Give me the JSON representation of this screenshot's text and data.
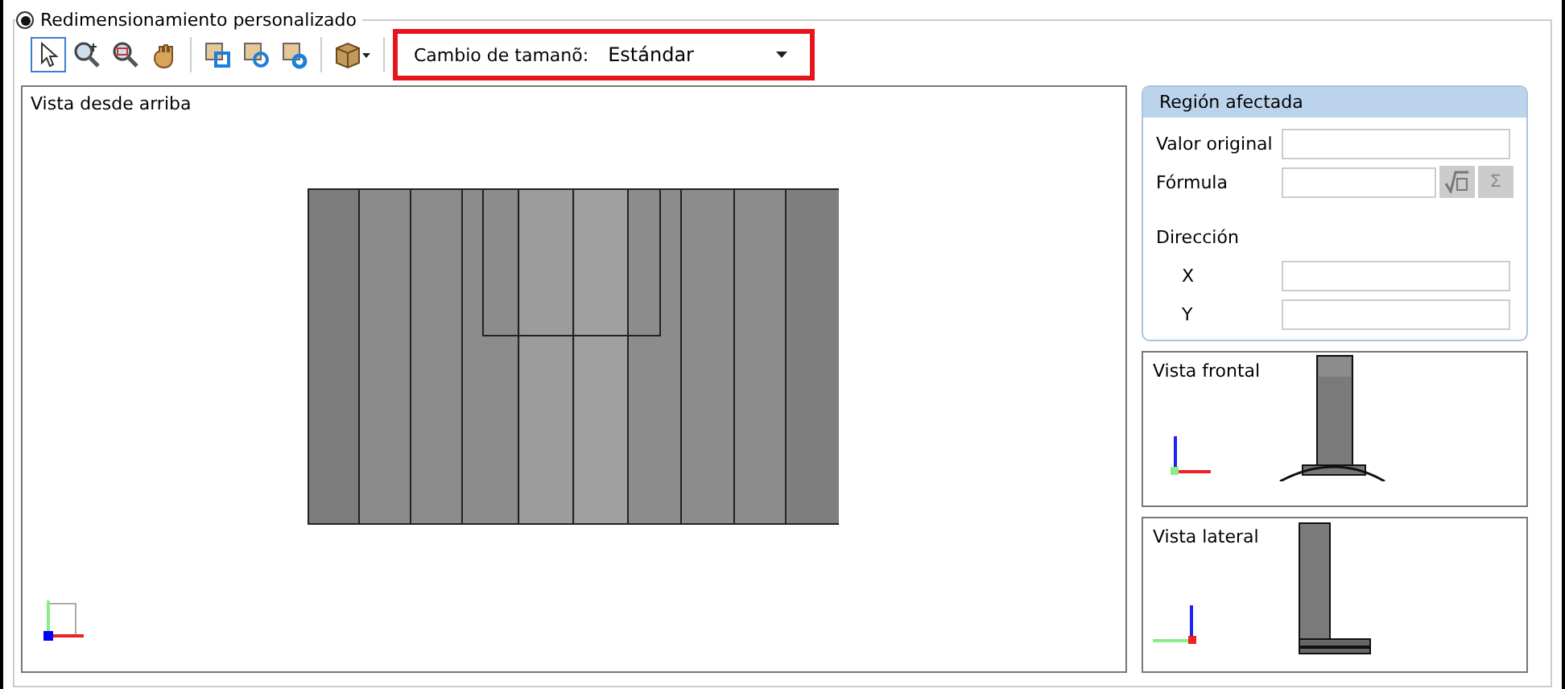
{
  "mode_radio": {
    "label": "Redimensionamiento personalizado",
    "selected": true
  },
  "toolbar": {
    "tools": [
      {
        "kind": "pointer",
        "selected": true
      },
      {
        "kind": "zoom",
        "selected": false
      },
      {
        "kind": "zoom-window",
        "selected": false
      },
      {
        "kind": "pan",
        "selected": false
      },
      {
        "kind": "square-select",
        "selected": false
      },
      {
        "kind": "circle-select",
        "selected": false
      },
      {
        "kind": "circle-select-alt",
        "selected": false
      },
      {
        "kind": "box-menu",
        "selected": false
      }
    ],
    "resize": {
      "label": "Cambio de tamanõ:",
      "value": "Estándar"
    }
  },
  "top_view": {
    "title": "Vista desde arriba"
  },
  "region": {
    "title": "Región afectada",
    "fields": [
      {
        "kind": "text",
        "label": "Valor original"
      },
      {
        "kind": "formula",
        "label": "Fórmula",
        "sigma": "Σ"
      },
      {
        "kind": "heading",
        "label": "Dirección"
      },
      {
        "kind": "axis",
        "label": "X"
      },
      {
        "kind": "axis",
        "label": "Y"
      }
    ]
  },
  "front_view": {
    "title": "Vista frontal"
  },
  "side_view": {
    "title": "Vista lateral"
  }
}
